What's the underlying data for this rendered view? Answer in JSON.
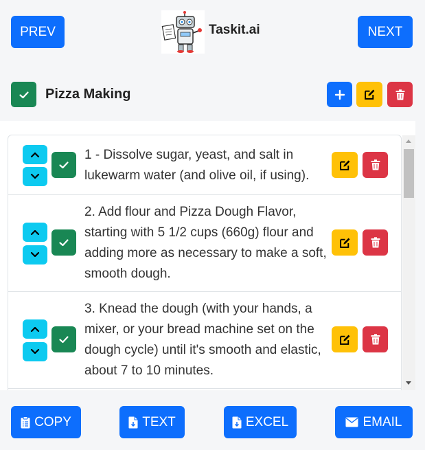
{
  "header": {
    "prev_label": "PREV",
    "next_label": "NEXT",
    "brand": "Taskit.ai"
  },
  "list": {
    "title": "Pizza Making",
    "completed": true
  },
  "items": [
    {
      "text": "1 - Dissolve sugar, yeast, and salt in lukewarm water (and olive oil, if using).",
      "completed": true
    },
    {
      "text": "2. Add flour and Pizza Dough Flavor, starting with 5 1/2 cups (660g) flour and adding more as necessary to make a soft, smooth dough.",
      "completed": true
    },
    {
      "text": "3. Knead the dough (with your hands, a mixer, or your bread machine set on the dough cycle) until it's smooth and elastic, about 7 to 10 minutes.",
      "completed": true
    }
  ],
  "footer": {
    "copy_label": "COPY",
    "text_label": "TEXT",
    "excel_label": "EXCEL",
    "email_label": "EMAIL"
  },
  "colors": {
    "primary": "#0d6efd",
    "warning": "#ffc107",
    "danger": "#dc3545",
    "info": "#0dcaf0",
    "success": "#198754"
  }
}
